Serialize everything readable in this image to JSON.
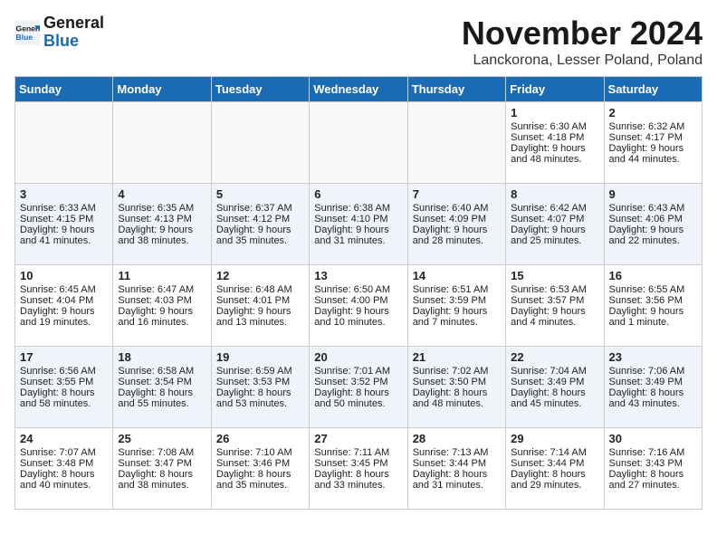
{
  "logo": {
    "line1": "General",
    "line2": "Blue"
  },
  "title": "November 2024",
  "location": "Lanckorona, Lesser Poland, Poland",
  "days_of_week": [
    "Sunday",
    "Monday",
    "Tuesday",
    "Wednesday",
    "Thursday",
    "Friday",
    "Saturday"
  ],
  "weeks": [
    [
      {
        "day": "",
        "info": ""
      },
      {
        "day": "",
        "info": ""
      },
      {
        "day": "",
        "info": ""
      },
      {
        "day": "",
        "info": ""
      },
      {
        "day": "",
        "info": ""
      },
      {
        "day": "1",
        "info": "Sunrise: 6:30 AM\nSunset: 4:18 PM\nDaylight: 9 hours and 48 minutes."
      },
      {
        "day": "2",
        "info": "Sunrise: 6:32 AM\nSunset: 4:17 PM\nDaylight: 9 hours and 44 minutes."
      }
    ],
    [
      {
        "day": "3",
        "info": "Sunrise: 6:33 AM\nSunset: 4:15 PM\nDaylight: 9 hours and 41 minutes."
      },
      {
        "day": "4",
        "info": "Sunrise: 6:35 AM\nSunset: 4:13 PM\nDaylight: 9 hours and 38 minutes."
      },
      {
        "day": "5",
        "info": "Sunrise: 6:37 AM\nSunset: 4:12 PM\nDaylight: 9 hours and 35 minutes."
      },
      {
        "day": "6",
        "info": "Sunrise: 6:38 AM\nSunset: 4:10 PM\nDaylight: 9 hours and 31 minutes."
      },
      {
        "day": "7",
        "info": "Sunrise: 6:40 AM\nSunset: 4:09 PM\nDaylight: 9 hours and 28 minutes."
      },
      {
        "day": "8",
        "info": "Sunrise: 6:42 AM\nSunset: 4:07 PM\nDaylight: 9 hours and 25 minutes."
      },
      {
        "day": "9",
        "info": "Sunrise: 6:43 AM\nSunset: 4:06 PM\nDaylight: 9 hours and 22 minutes."
      }
    ],
    [
      {
        "day": "10",
        "info": "Sunrise: 6:45 AM\nSunset: 4:04 PM\nDaylight: 9 hours and 19 minutes."
      },
      {
        "day": "11",
        "info": "Sunrise: 6:47 AM\nSunset: 4:03 PM\nDaylight: 9 hours and 16 minutes."
      },
      {
        "day": "12",
        "info": "Sunrise: 6:48 AM\nSunset: 4:01 PM\nDaylight: 9 hours and 13 minutes."
      },
      {
        "day": "13",
        "info": "Sunrise: 6:50 AM\nSunset: 4:00 PM\nDaylight: 9 hours and 10 minutes."
      },
      {
        "day": "14",
        "info": "Sunrise: 6:51 AM\nSunset: 3:59 PM\nDaylight: 9 hours and 7 minutes."
      },
      {
        "day": "15",
        "info": "Sunrise: 6:53 AM\nSunset: 3:57 PM\nDaylight: 9 hours and 4 minutes."
      },
      {
        "day": "16",
        "info": "Sunrise: 6:55 AM\nSunset: 3:56 PM\nDaylight: 9 hours and 1 minute."
      }
    ],
    [
      {
        "day": "17",
        "info": "Sunrise: 6:56 AM\nSunset: 3:55 PM\nDaylight: 8 hours and 58 minutes."
      },
      {
        "day": "18",
        "info": "Sunrise: 6:58 AM\nSunset: 3:54 PM\nDaylight: 8 hours and 55 minutes."
      },
      {
        "day": "19",
        "info": "Sunrise: 6:59 AM\nSunset: 3:53 PM\nDaylight: 8 hours and 53 minutes."
      },
      {
        "day": "20",
        "info": "Sunrise: 7:01 AM\nSunset: 3:52 PM\nDaylight: 8 hours and 50 minutes."
      },
      {
        "day": "21",
        "info": "Sunrise: 7:02 AM\nSunset: 3:50 PM\nDaylight: 8 hours and 48 minutes."
      },
      {
        "day": "22",
        "info": "Sunrise: 7:04 AM\nSunset: 3:49 PM\nDaylight: 8 hours and 45 minutes."
      },
      {
        "day": "23",
        "info": "Sunrise: 7:06 AM\nSunset: 3:49 PM\nDaylight: 8 hours and 43 minutes."
      }
    ],
    [
      {
        "day": "24",
        "info": "Sunrise: 7:07 AM\nSunset: 3:48 PM\nDaylight: 8 hours and 40 minutes."
      },
      {
        "day": "25",
        "info": "Sunrise: 7:08 AM\nSunset: 3:47 PM\nDaylight: 8 hours and 38 minutes."
      },
      {
        "day": "26",
        "info": "Sunrise: 7:10 AM\nSunset: 3:46 PM\nDaylight: 8 hours and 35 minutes."
      },
      {
        "day": "27",
        "info": "Sunrise: 7:11 AM\nSunset: 3:45 PM\nDaylight: 8 hours and 33 minutes."
      },
      {
        "day": "28",
        "info": "Sunrise: 7:13 AM\nSunset: 3:44 PM\nDaylight: 8 hours and 31 minutes."
      },
      {
        "day": "29",
        "info": "Sunrise: 7:14 AM\nSunset: 3:44 PM\nDaylight: 8 hours and 29 minutes."
      },
      {
        "day": "30",
        "info": "Sunrise: 7:16 AM\nSunset: 3:43 PM\nDaylight: 8 hours and 27 minutes."
      }
    ]
  ]
}
